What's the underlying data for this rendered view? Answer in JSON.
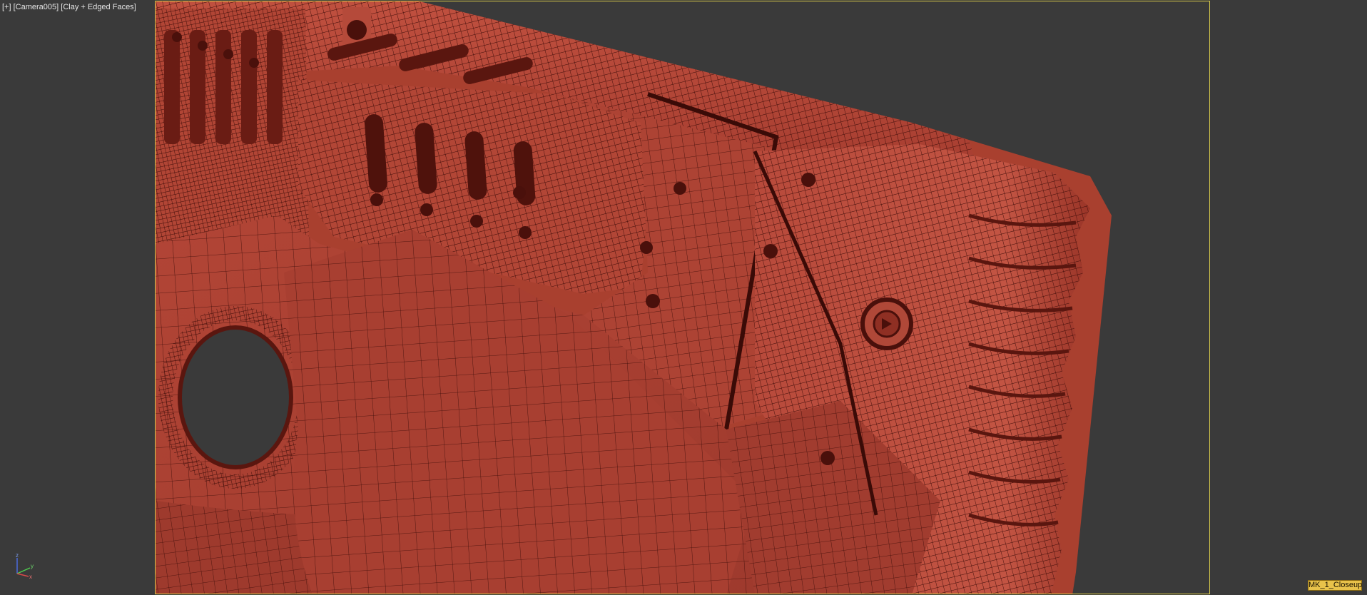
{
  "viewport": {
    "label_plus": "[+]",
    "label_camera": "[Camera005]",
    "label_shading": "[Clay + Edged Faces]",
    "camera_tag": "MK_1_Closeup",
    "colors": {
      "background": "#3a3a3a",
      "safe_frame_border": "#d6c84a",
      "model_fill": "#b5463a",
      "model_shadow": "#5a1510",
      "wire": "#3d0c08",
      "camera_tag_bg": "#e8c24a"
    },
    "gizmo": {
      "axis_z": "z",
      "axis_y": "y",
      "axis_x": "x"
    },
    "icons": [
      "axis-gizmo-icon"
    ]
  }
}
